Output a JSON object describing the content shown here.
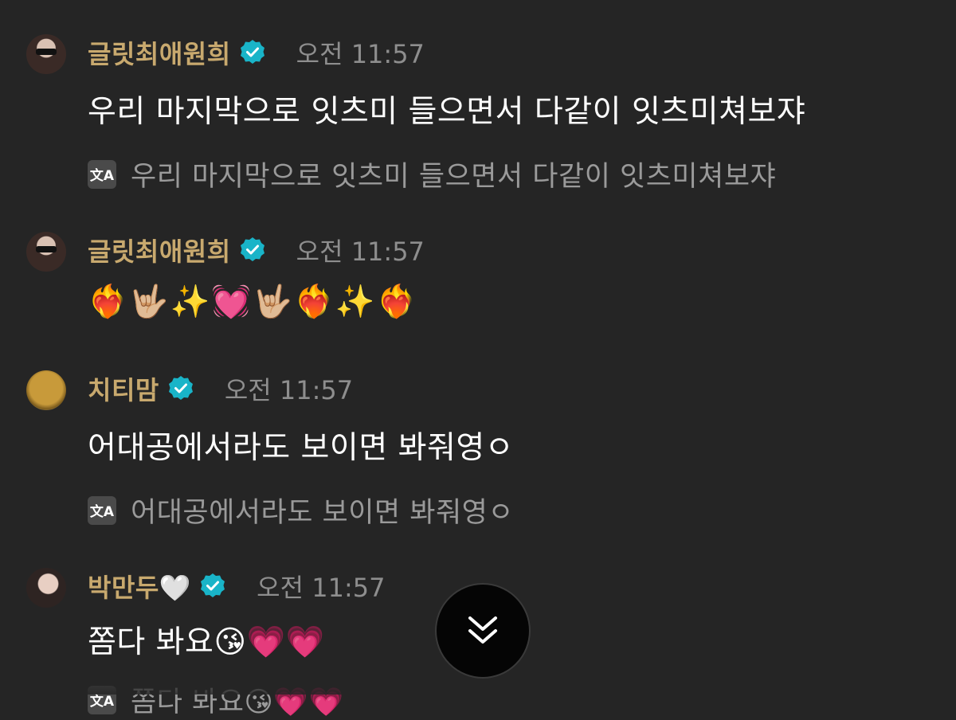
{
  "messages": [
    {
      "author": "글릿최애원희",
      "time": "오전 11:57",
      "text": "우리 마지막으로 잇츠미 들으면서 다같이 잇츠미쳐보쟈",
      "translation": "우리 마지막으로 잇츠미 들으면서 다같이 잇츠미쳐보쟈"
    },
    {
      "author": "글릿최애원희",
      "time": "오전 11:57",
      "text": "❤️‍🔥🤟🏼✨💓🤟🏼❤️‍🔥✨❤️‍🔥"
    },
    {
      "author": "치티맘",
      "time": "오전 11:57",
      "text": "어대공에서라도 보이면 봐줘영ㅇ",
      "translation": "어대공에서라도 보이면 봐줘영ㅇ"
    },
    {
      "author": "박만두🤍",
      "time": "오전 11:57",
      "text": "쫌다 봐요😘💗💗",
      "translation": "쫌다 봐요😘💗💗"
    }
  ],
  "translate_icon_label": "文A",
  "colors": {
    "background": "#252525",
    "author": "#c8a96e",
    "verified": "#19b4c8",
    "time": "#8e8e8e",
    "translation": "#9a9a9a"
  },
  "icons": {
    "verified": "verified-badge-icon",
    "translate": "translate-icon",
    "scroll_down": "double-chevron-down-icon"
  }
}
